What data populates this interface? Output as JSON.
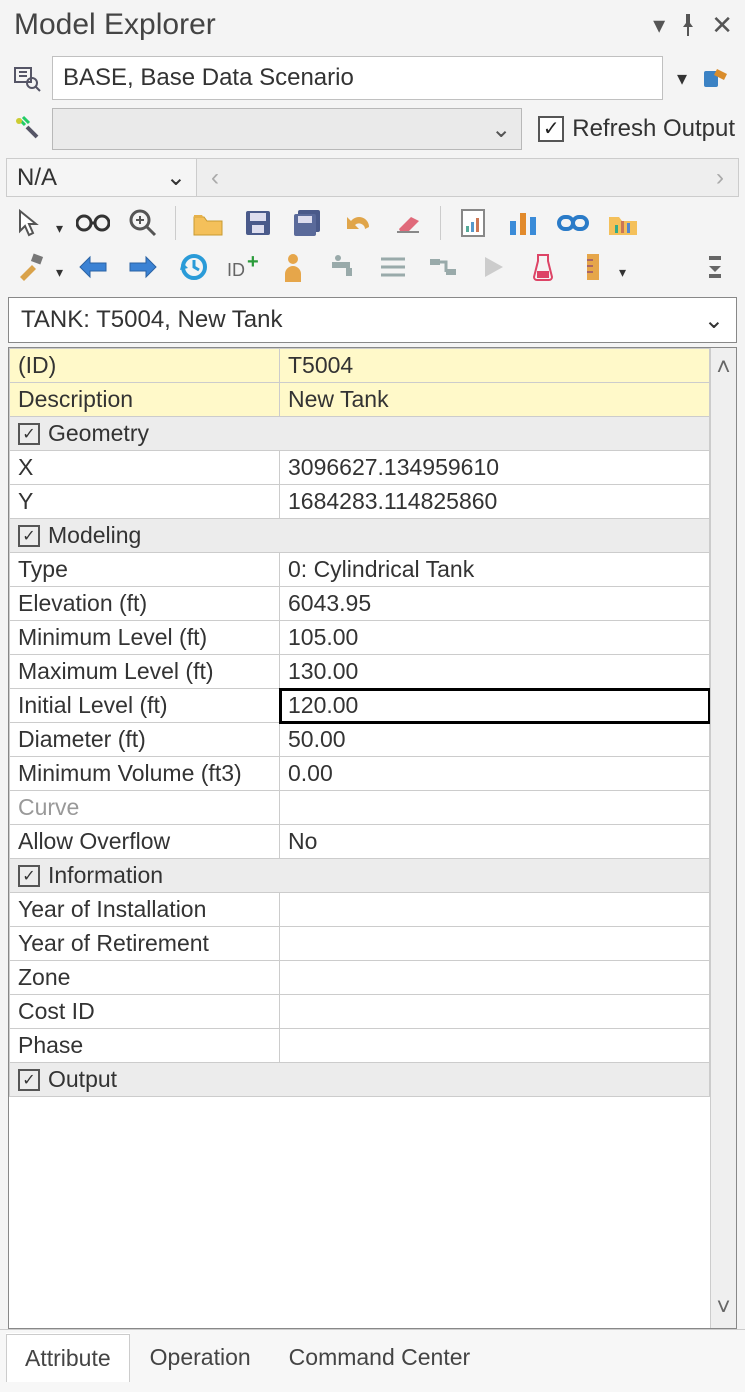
{
  "window": {
    "title": "Model Explorer"
  },
  "scenario": {
    "value": "BASE, Base Data Scenario"
  },
  "refresh": {
    "checked": true,
    "label": "Refresh Output"
  },
  "nav": {
    "na_label": "N/A"
  },
  "element_selector": {
    "value": "TANK: T5004, New Tank"
  },
  "grid": {
    "id_row": {
      "label": "(ID)",
      "value": "T5004"
    },
    "desc_row": {
      "label": "Description",
      "value": "New Tank"
    },
    "sections": {
      "geometry": {
        "title": "Geometry",
        "checked": true
      },
      "modeling": {
        "title": "Modeling",
        "checked": true
      },
      "information": {
        "title": "Information",
        "checked": true
      },
      "output": {
        "title": "Output",
        "checked": true
      }
    },
    "rows": {
      "x": {
        "label": "X",
        "value": "3096627.134959610"
      },
      "y": {
        "label": "Y",
        "value": "1684283.114825860"
      },
      "type": {
        "label": "Type",
        "value": "0: Cylindrical Tank"
      },
      "elevation": {
        "label": "Elevation (ft)",
        "value": "6043.95"
      },
      "min_level": {
        "label": "Minimum Level (ft)",
        "value": "105.00"
      },
      "max_level": {
        "label": "Maximum Level (ft)",
        "value": "130.00"
      },
      "init_level": {
        "label": "Initial Level (ft)",
        "value": "120.00"
      },
      "diameter": {
        "label": "Diameter (ft)",
        "value": "50.00"
      },
      "min_volume": {
        "label": "Minimum Volume (ft3)",
        "value": "0.00"
      },
      "curve": {
        "label": "Curve",
        "value": ""
      },
      "overflow": {
        "label": "Allow Overflow",
        "value": "No"
      },
      "year_install": {
        "label": "Year of Installation",
        "value": ""
      },
      "year_retire": {
        "label": "Year of Retirement",
        "value": ""
      },
      "zone": {
        "label": "Zone",
        "value": ""
      },
      "cost_id": {
        "label": "Cost ID",
        "value": ""
      },
      "phase": {
        "label": "Phase",
        "value": ""
      }
    }
  },
  "tabs": {
    "attribute": "Attribute",
    "operation": "Operation",
    "command": "Command Center"
  }
}
